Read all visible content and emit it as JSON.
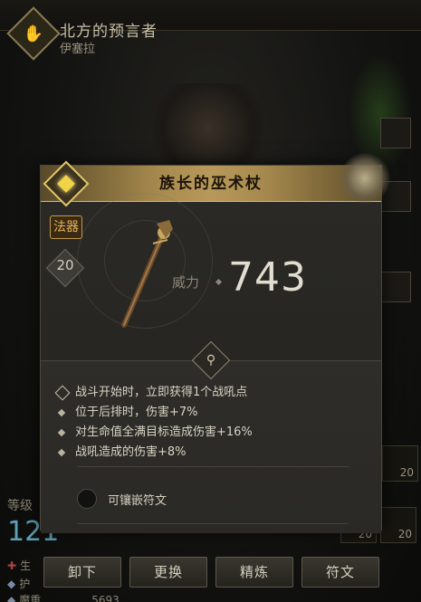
{
  "hero": {
    "name": "北方的预言者",
    "subtitle": "伊塞拉"
  },
  "stats": {
    "level_label": "等级",
    "level_value": "121",
    "row1_label": "生",
    "row2_label": "护",
    "row3_label": "魔重",
    "row3_value": "5693"
  },
  "side": {
    "slot_value_a": "20",
    "slot_value_b": "20",
    "slot_value_c": "20"
  },
  "item": {
    "title": "族长的巫术杖",
    "category": "法器",
    "level": "20",
    "power_label": "威力",
    "power_value": "743",
    "effects": [
      "战斗开始时，立即获得1个战吼点",
      "位于后排时，伤害+7%",
      "对生命值全满目标造成伤害+16%",
      "战吼造成的伤害+8%"
    ],
    "socket_label": "可镶嵌符文"
  },
  "buttons": {
    "unequip": "卸下",
    "replace": "更换",
    "refine": "精炼",
    "rune": "符文"
  },
  "colors": {
    "header_gold": "#b7995a",
    "category_orange": "#e6b45a",
    "stat_blue": "#5fa0b5"
  }
}
